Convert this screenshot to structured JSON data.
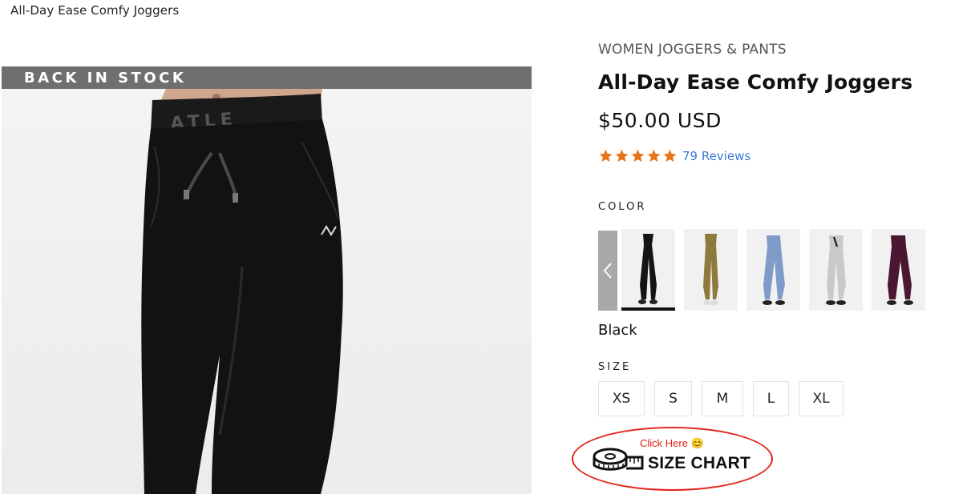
{
  "page": {
    "title": "All-Day Ease Comfy Joggers"
  },
  "gallery": {
    "banner": "BACK IN STOCK",
    "brand_mark": "ATLE"
  },
  "product": {
    "category": "WOMEN JOGGERS & PANTS",
    "name": "All-Day Ease Comfy Joggers",
    "price": "$50.00 USD",
    "rating": 5,
    "reviews_label": "79 Reviews"
  },
  "color": {
    "label": "COLOR",
    "selected": "Black",
    "swatches": [
      {
        "name": "Black",
        "hex": "#141414",
        "selected": true
      },
      {
        "name": "Olive",
        "hex": "#8d7a3c",
        "selected": false
      },
      {
        "name": "Blue",
        "hex": "#7f9cc8",
        "selected": false
      },
      {
        "name": "Grey",
        "hex": "#c9c9c9",
        "selected": false
      },
      {
        "name": "Burgundy",
        "hex": "#4b1730",
        "selected": false
      }
    ]
  },
  "size": {
    "label": "SIZE",
    "options": [
      "XS",
      "S",
      "M",
      "L",
      "XL"
    ]
  },
  "size_chart": {
    "hint": "Click Here 😊",
    "label": "SIZE CHART"
  },
  "colors": {
    "star": "#e8731c",
    "link": "#3b7bd6",
    "banner": "#6f6f6f",
    "oval": "#e2231a"
  }
}
